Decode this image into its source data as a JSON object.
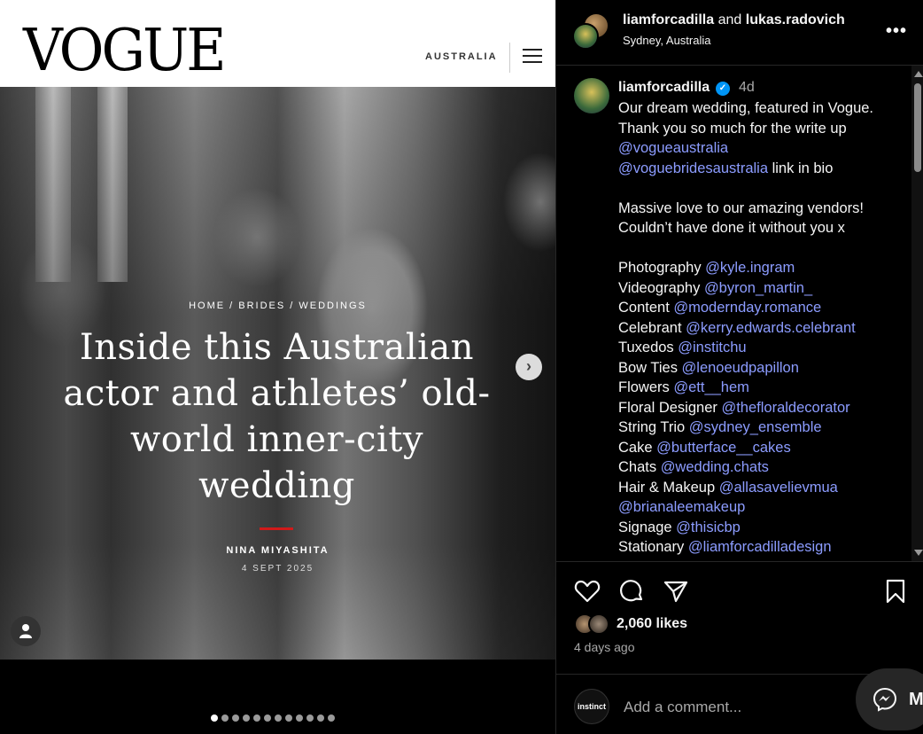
{
  "vogue": {
    "logo": "VOGUE",
    "region": "AUSTRALIA",
    "breadcrumb": "HOME / BRIDES / WEDDINGS",
    "headline": "Inside this Australian actor and athletes’ old-world inner-city wedding",
    "author": "NINA MIYASHITA",
    "date": "4 SEPT 2025"
  },
  "carousel": {
    "total": 12,
    "active": 1
  },
  "post": {
    "head_user1": "liamforcadilla",
    "head_and": " and ",
    "head_user2": "lukas.radovich",
    "location": "Sydney, Australia",
    "caption_user": "liamforcadilla",
    "caption_time": "4d",
    "likes": "2,060 likes",
    "ago": "4 days ago",
    "comment_placeholder": "Add a comment...",
    "commenter_avatar": "instinct",
    "messages_label": "M"
  },
  "caption": {
    "line1": "Our dream wedding, featured in Vogue.",
    "line2": "Thank you so much for the write up",
    "line3_mention": "@vogueaustralia",
    "line4_mention": "@voguebridesaustralia",
    "line4_text": " link in bio",
    "line5": "Massive love to our amazing vendors!",
    "line6": "Couldn’t have done it without you x",
    "credits": [
      {
        "role": "Photography ",
        "handle": "@kyle.ingram"
      },
      {
        "role": "Videography ",
        "handle": "@byron_martin_"
      },
      {
        "role": "Content ",
        "handle": "@modernday.romance"
      },
      {
        "role": "Celebrant ",
        "handle": "@kerry.edwards.celebrant"
      },
      {
        "role": "Tuxedos ",
        "handle": "@institchu"
      },
      {
        "role": "Bow Ties ",
        "handle": "@lenoeudpapillon"
      },
      {
        "role": "Flowers ",
        "handle": "@ett__hem"
      },
      {
        "role": "Floral Designer ",
        "handle": "@thefloraldecorator"
      },
      {
        "role": "String Trio ",
        "handle": "@sydney_ensemble"
      },
      {
        "role": "Cake ",
        "handle": "@butterface__cakes"
      },
      {
        "role": "Chats ",
        "handle": "@wedding.chats"
      },
      {
        "role": "Hair & Makeup ",
        "handle": "@allasavelievmua"
      },
      {
        "role": "",
        "handle": "@brianaleemakeup"
      },
      {
        "role": "Signage ",
        "handle": "@thisicbp"
      },
      {
        "role": "Stationary ",
        "handle": "@liamforcadilladesign"
      }
    ]
  },
  "colors": {
    "background": "#000000",
    "mention": "#8c9cff",
    "verified": "#0095f6",
    "accent_red": "#d11a1a",
    "muted": "#a8a8a8"
  },
  "icons": [
    "heart-icon",
    "comment-icon",
    "share-icon",
    "bookmark-icon",
    "more-icon",
    "verified-icon",
    "messenger-icon",
    "hamburger-icon",
    "chevron-right-icon",
    "user-icon"
  ]
}
